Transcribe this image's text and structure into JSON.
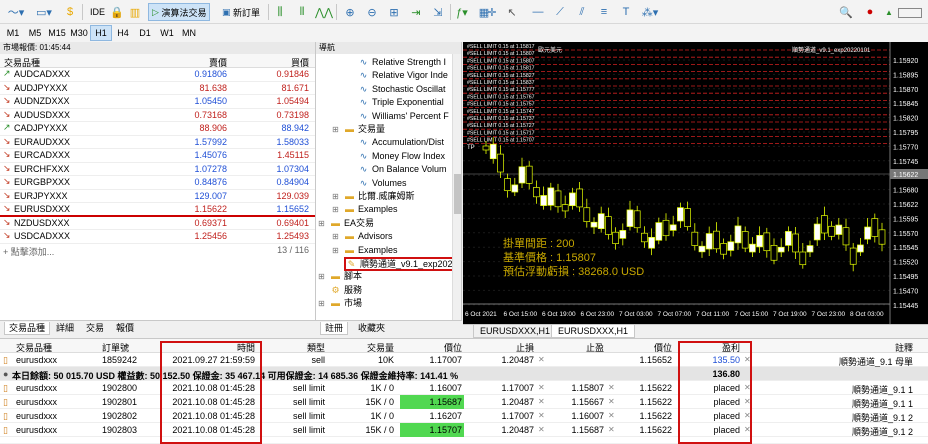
{
  "toolbar": {
    "algo_label": "演算法交易",
    "new_order_label": "新訂單",
    "ide_label": "IDE",
    "status_label": "LVL"
  },
  "timeframes": [
    "M1",
    "M5",
    "M15",
    "M30",
    "H1",
    "H4",
    "D1",
    "W1",
    "MN"
  ],
  "market_watch": {
    "title": "市場報價: 01:45:44",
    "col_symbol": "交易品種",
    "col_bid": "賣價",
    "col_ask": "買價",
    "rows": [
      {
        "symbol": "AUDCADXXX",
        "bid": "0.91806",
        "ask": "0.91846",
        "dir": "up",
        "bid_color": "blue",
        "ask_color": "red"
      },
      {
        "symbol": "AUDJPYXXX",
        "bid": "81.638",
        "ask": "81.671",
        "dir": "dn",
        "bid_color": "red",
        "ask_color": "red"
      },
      {
        "symbol": "AUDNZDXXX",
        "bid": "1.05450",
        "ask": "1.05494",
        "dir": "dn",
        "bid_color": "blue",
        "ask_color": "red"
      },
      {
        "symbol": "AUDUSDXXX",
        "bid": "0.73168",
        "ask": "0.73198",
        "dir": "dn",
        "bid_color": "red",
        "ask_color": "red"
      },
      {
        "symbol": "CADJPYXXX",
        "bid": "88.906",
        "ask": "88.942",
        "dir": "up",
        "bid_color": "red",
        "ask_color": "blue"
      },
      {
        "symbol": "EURAUDXXX",
        "bid": "1.57992",
        "ask": "1.58033",
        "dir": "dn",
        "bid_color": "blue",
        "ask_color": "blue"
      },
      {
        "symbol": "EURCADXXX",
        "bid": "1.45076",
        "ask": "1.45115",
        "dir": "dn",
        "bid_color": "blue",
        "ask_color": "red"
      },
      {
        "symbol": "EURCHFXXX",
        "bid": "1.07278",
        "ask": "1.07304",
        "dir": "dn",
        "bid_color": "blue",
        "ask_color": "blue"
      },
      {
        "symbol": "EURGBPXXX",
        "bid": "0.84876",
        "ask": "0.84904",
        "dir": "dn",
        "bid_color": "blue",
        "ask_color": "blue"
      },
      {
        "symbol": "EURJPYXXX",
        "bid": "129.007",
        "ask": "129.039",
        "dir": "dn",
        "bid_color": "blue",
        "ask_color": "red"
      },
      {
        "symbol": "EURUSDXXX",
        "bid": "1.15622",
        "ask": "1.15652",
        "dir": "dn",
        "bid_color": "red",
        "ask_color": "blue"
      },
      {
        "symbol": "NZDUSDXXX",
        "bid": "0.69371",
        "ask": "0.69401",
        "dir": "dn",
        "bid_color": "red",
        "ask_color": "red"
      },
      {
        "symbol": "USDCADXXX",
        "bid": "1.25456",
        "ask": "1.25493",
        "dir": "dn",
        "bid_color": "red",
        "ask_color": "red"
      }
    ],
    "add_label": "點擊添加...",
    "count": "13 / 116",
    "tabs": [
      "交易品種",
      "詳細",
      "交易",
      "報價"
    ]
  },
  "navigator": {
    "title": "導航",
    "items": [
      {
        "label": "Relative Strength I",
        "type": "ind"
      },
      {
        "label": "Relative Vigor Inde",
        "type": "ind"
      },
      {
        "label": "Stochastic Oscillat",
        "type": "ind"
      },
      {
        "label": "Triple Exponential",
        "type": "ind"
      },
      {
        "label": "Williams' Percent F",
        "type": "ind"
      },
      {
        "label": "交易量",
        "type": "folder"
      },
      {
        "label": "Accumulation/Dist",
        "type": "ind"
      },
      {
        "label": "Money Flow Index",
        "type": "ind"
      },
      {
        "label": "On Balance Volum",
        "type": "ind"
      },
      {
        "label": "Volumes",
        "type": "ind"
      },
      {
        "label": "比爾.威廉姆斯",
        "type": "folder"
      },
      {
        "label": "Examples",
        "type": "folder"
      },
      {
        "label": "EA交易",
        "type": "folder"
      },
      {
        "label": "Advisors",
        "type": "folder"
      },
      {
        "label": "Examples",
        "type": "folder"
      },
      {
        "label": "順勢通道_v9.1_exp202",
        "type": "ea"
      },
      {
        "label": "腳本",
        "type": "folder"
      },
      {
        "label": "服務",
        "type": "svc"
      },
      {
        "label": "市場",
        "type": "folder"
      }
    ],
    "tabs": [
      "註冊",
      "收藏夾"
    ]
  },
  "chart": {
    "title_left": "歐元美元",
    "ea_name": "順勢通道_v9.1_exp20220101",
    "sell_limit_labels": [
      "#SELL LIMIT 0.15 at 1.15817",
      "#SELL LIMIT 0.15 at 1.15807",
      "#SELL LIMIT 0.15 at 1.15807",
      "#SELL LIMIT 0.15 at 1.15817",
      "#SELL LIMIT 0.15 at 1.15827",
      "#SELL LIMIT 0.15 at 1.15837",
      "#SELL LIMIT 0.15 at 1.15777",
      "#SELL LIMIT 0.15 at 1.15767",
      "#SELL LIMIT 0.15 at 1.15757",
      "#SELL LIMIT 0.15 at 1.15747",
      "#SELL LIMIT 0.15 at 1.15737",
      "#SELL LIMIT 0.15 at 1.15727",
      "#SELL LIMIT 0.15 at 1.15717",
      "#SELL LIMIT 0.15 at 1.15707"
    ],
    "tp_label": "TP",
    "info_line1": "掛單間距 : 200",
    "info_line2": "基準價格 : 1.15807",
    "info_line3": "預估浮動虧損 : 38268.0 USD",
    "y_ticks": [
      "1.15920",
      "1.15895",
      "1.15870",
      "1.15845",
      "1.15820",
      "1.15795",
      "1.15770",
      "1.15745",
      "1.15720",
      "1.15680",
      "1.15622",
      "1.15595",
      "1.15570",
      "1.15545",
      "1.15520",
      "1.15495",
      "1.15470",
      "1.15445"
    ],
    "current_price": "1.15622",
    "x_ticks": [
      "6 Oct 2021",
      "6 Oct 15:00",
      "6 Oct 19:00",
      "6 Oct 23:00",
      "7 Oct 03:00",
      "7 Oct 07:00",
      "7 Oct 11:00",
      "7 Oct 15:00",
      "7 Oct 19:00",
      "7 Oct 23:00",
      "8 Oct 03:00"
    ],
    "tabs": [
      "EURUSDXXX,H1",
      "EURUSDXXX,H1"
    ],
    "accent_color": "#c8a800"
  },
  "terminal": {
    "headers": {
      "symbol": "交易品種",
      "order": "訂單號",
      "time": "時間",
      "type": "類型",
      "volume": "交易量",
      "price": "價位",
      "sl": "止損",
      "tp": "止盈",
      "cur_price": "價位",
      "profit": "盈利",
      "comment": "註釋"
    },
    "positions": [
      {
        "symbol": "eurusdxxx",
        "order": "1859242",
        "time": "2021.09.27 21:59:59",
        "type": "sell",
        "volume": "10K",
        "price": "1.17007",
        "sl": "1.20487",
        "tp": "",
        "cur_price": "1.15652",
        "profit": "135.50",
        "comment": "順勢通道_9.1 母單"
      }
    ],
    "summary": {
      "text": "本日餘額: 50 015.70 USD  權益數: 50 152.50  保證金: 35 467.14  可用保證金: 14 685.36  保證金維持率: 141.41 %",
      "profit": "136.80"
    },
    "orders": [
      {
        "symbol": "eurusdxxx",
        "order": "1902800",
        "time": "2021.10.08 01:45:28",
        "type": "sell limit",
        "volume": "1K / 0",
        "price": "1.16007",
        "sl": "1.17007",
        "tp": "1.15807",
        "cur_price": "1.15622",
        "profit": "placed",
        "comment": "順勢通道_9.1 1",
        "green": false
      },
      {
        "symbol": "eurusdxxx",
        "order": "1902801",
        "time": "2021.10.08 01:45:28",
        "type": "sell limit",
        "volume": "15K / 0",
        "price": "1.15687",
        "sl": "1.20487",
        "tp": "1.15667",
        "cur_price": "1.15622",
        "profit": "placed",
        "comment": "順勢通道_9.1 1",
        "green": true
      },
      {
        "symbol": "eurusdxxx",
        "order": "1902802",
        "time": "2021.10.08 01:45:28",
        "type": "sell limit",
        "volume": "1K / 0",
        "price": "1.16207",
        "sl": "1.17007",
        "tp": "1.16007",
        "cur_price": "1.15622",
        "profit": "placed",
        "comment": "順勢通道_9.1 2",
        "green": false
      },
      {
        "symbol": "eurusdxxx",
        "order": "1902803",
        "time": "2021.10.08 01:45:28",
        "type": "sell limit",
        "volume": "15K / 0",
        "price": "1.15707",
        "sl": "1.20487",
        "tp": "1.15687",
        "cur_price": "1.15622",
        "profit": "placed",
        "comment": "順勢通道_9.1 2",
        "green": true
      }
    ]
  }
}
